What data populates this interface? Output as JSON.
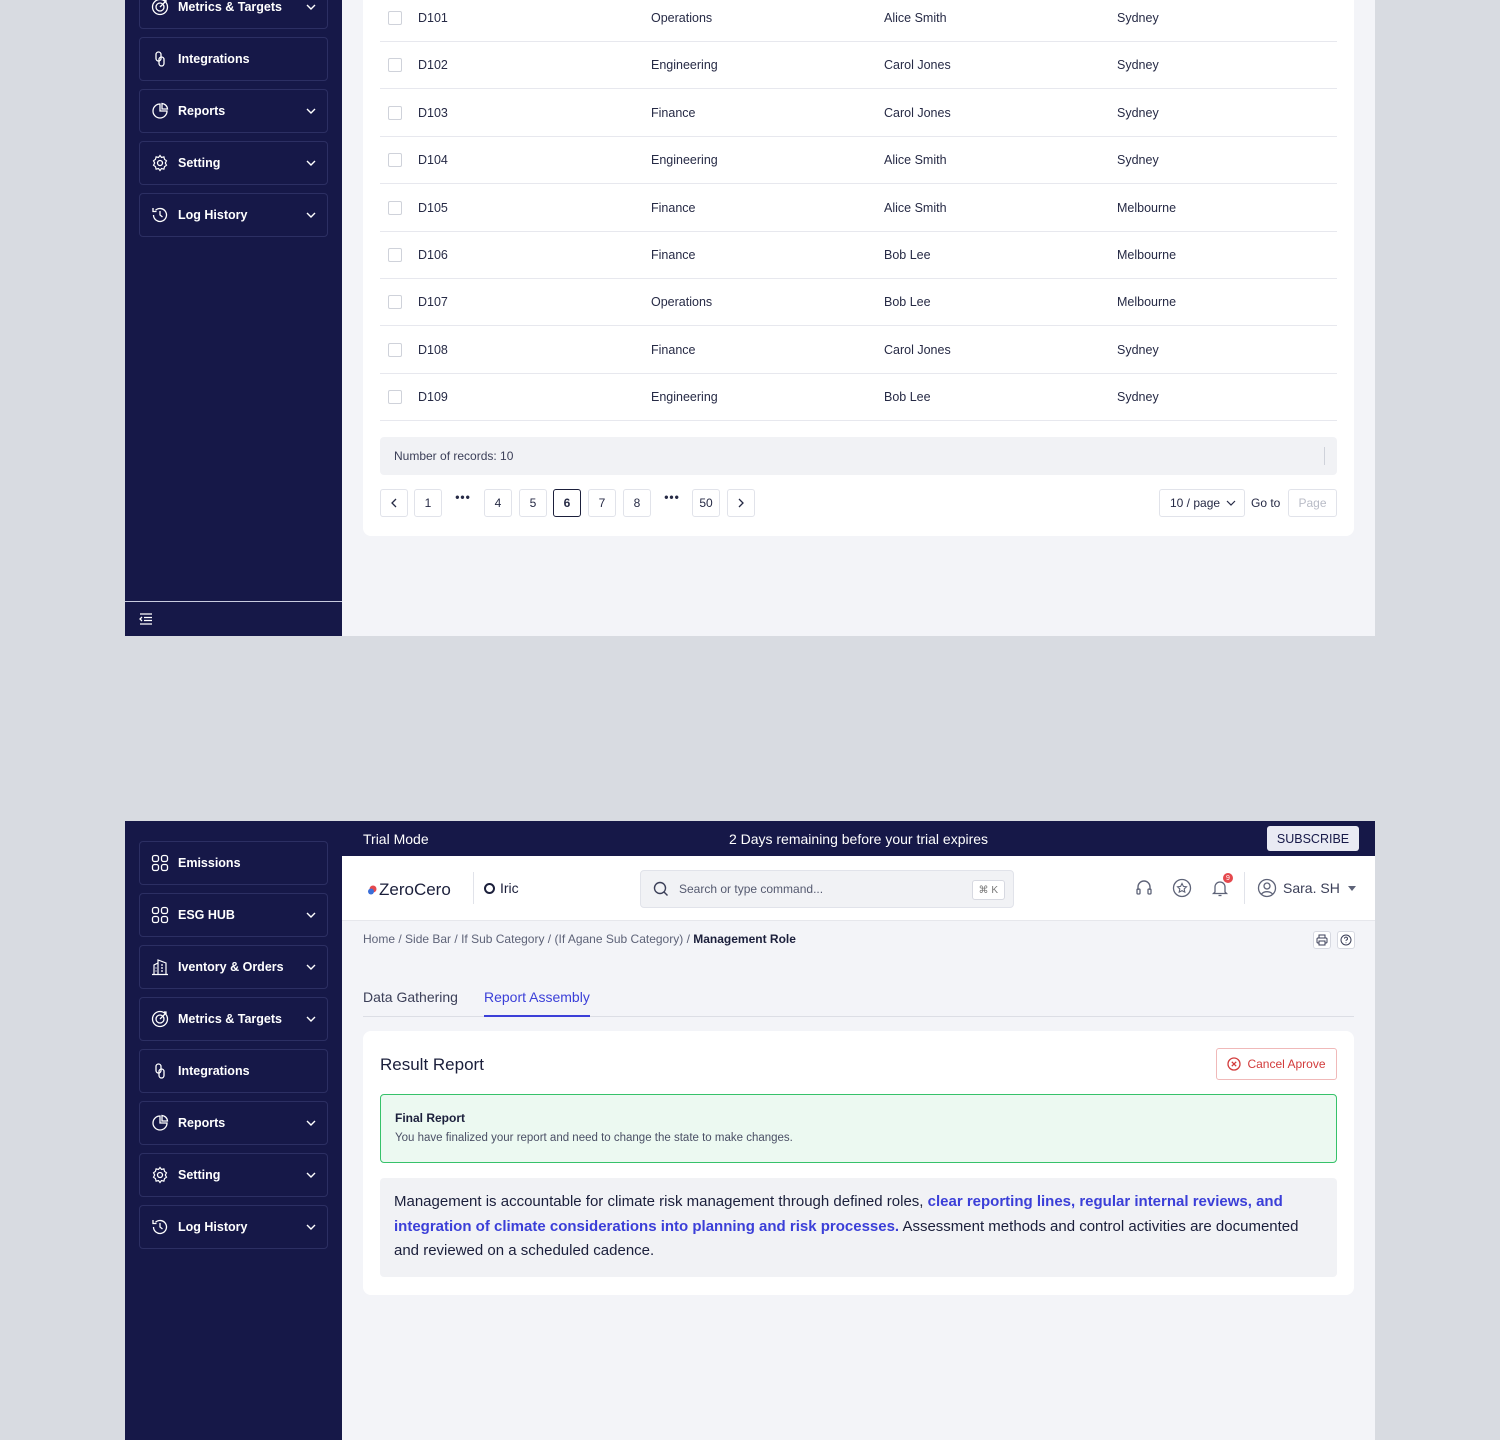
{
  "sidebar_top": {
    "items": [
      {
        "label": "Metrics & Targets",
        "icon": "target-icon",
        "chevron": true
      },
      {
        "label": "Integrations",
        "icon": "link-icon",
        "chevron": false
      },
      {
        "label": "Reports",
        "icon": "pie-chart-icon",
        "chevron": true
      },
      {
        "label": "Setting",
        "icon": "gear-icon",
        "chevron": true
      },
      {
        "label": "Log History",
        "icon": "history-icon",
        "chevron": true
      }
    ]
  },
  "table": {
    "rows": [
      {
        "id": "D101",
        "department": "Operations",
        "manager": "Alice Smith",
        "city": "Sydney"
      },
      {
        "id": "D102",
        "department": "Engineering",
        "manager": "Carol Jones",
        "city": "Sydney"
      },
      {
        "id": "D103",
        "department": "Finance",
        "manager": "Carol Jones",
        "city": "Sydney"
      },
      {
        "id": "D104",
        "department": "Engineering",
        "manager": "Alice Smith",
        "city": "Sydney"
      },
      {
        "id": "D105",
        "department": "Finance",
        "manager": "Alice Smith",
        "city": "Melbourne"
      },
      {
        "id": "D106",
        "department": "Finance",
        "manager": "Bob Lee",
        "city": "Melbourne"
      },
      {
        "id": "D107",
        "department": "Operations",
        "manager": "Bob Lee",
        "city": "Melbourne"
      },
      {
        "id": "D108",
        "department": "Finance",
        "manager": "Carol Jones",
        "city": "Sydney"
      },
      {
        "id": "D109",
        "department": "Engineering",
        "manager": "Bob Lee",
        "city": "Sydney"
      }
    ],
    "records_label": "Number of records: 10",
    "pages": [
      "1",
      "4",
      "5",
      "6",
      "7",
      "8",
      "50"
    ],
    "current_page": "6",
    "page_size": "10 / page",
    "goto_label": "Go to",
    "goto_placeholder": "Page"
  },
  "sidebar_bottom": {
    "items": [
      {
        "label": "Emissions",
        "icon": "grid-icon",
        "chevron": false
      },
      {
        "label": "ESG HUB",
        "icon": "grid-icon",
        "chevron": true
      },
      {
        "label": "Iventory & Orders",
        "icon": "building-icon",
        "chevron": true
      },
      {
        "label": "Metrics & Targets",
        "icon": "target-icon",
        "chevron": true
      },
      {
        "label": "Integrations",
        "icon": "link-icon",
        "chevron": false
      },
      {
        "label": "Reports",
        "icon": "pie-chart-icon",
        "chevron": true
      },
      {
        "label": "Setting",
        "icon": "gear-icon",
        "chevron": true
      },
      {
        "label": "Log History",
        "icon": "history-icon",
        "chevron": true
      }
    ]
  },
  "trial": {
    "mode": "Trial Mode",
    "message": "2 Days remaining before your trial expires",
    "subscribe": "SUBSCRIBE"
  },
  "header": {
    "brand": "ZeroCero",
    "org": "Iric",
    "search_placeholder": "Search or type command...",
    "search_shortcut": "⌘ K",
    "notification_count": "9",
    "user_name": "Sara. SH"
  },
  "breadcrumb": {
    "items": [
      "Home",
      "Side Bar",
      "If Sub Category",
      "(If Agane Sub Category)"
    ],
    "current": "Management Role"
  },
  "tabs": [
    {
      "label": "Data Gathering",
      "active": false
    },
    {
      "label": "Report Assembly",
      "active": true
    }
  ],
  "report": {
    "title": "Result Report",
    "cancel_label": "Cancel Aprove",
    "final_title": "Final Report",
    "final_desc": "You have finalized your report and need to change the state to make changes.",
    "text_before": "Management is accountable for climate risk management through defined roles, ",
    "text_highlight": "clear reporting lines, regular internal reviews, and integration of climate considerations into planning and risk processes.",
    "text_after": " Assessment methods and control activities are documented and reviewed on a scheduled cadence."
  },
  "colors": {
    "sidebar": "#161848",
    "accent": "#3b3fd8",
    "success_border": "#36c26a",
    "danger": "#d23b3b"
  }
}
